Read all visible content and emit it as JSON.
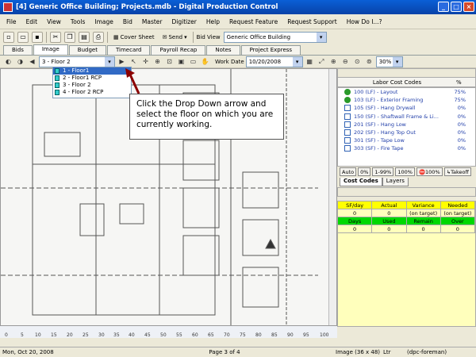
{
  "window": {
    "title": "[4] Generic Office Building; Projects.mdb - Digital Production Control"
  },
  "menu": [
    "File",
    "Edit",
    "View",
    "Tools",
    "Image",
    "Bid",
    "Master",
    "Digitizer",
    "Help",
    "Request Feature",
    "Request Support",
    "How Do I...?"
  ],
  "toolbar": {
    "cover_sheet": "Cover Sheet",
    "send": "Send",
    "bid_view_label": "Bid View",
    "bid_view_value": "Generic Office Building"
  },
  "tabs": [
    "Bids",
    "Image",
    "Budget",
    "Timecard",
    "Payroll Recap",
    "Notes",
    "Project Express"
  ],
  "imgbar": {
    "floor_value": "3 - Floor 2",
    "work_date_label": "Work Date",
    "work_date_value": "10/20/2008",
    "zoom_value": "30%"
  },
  "floors": [
    "1 - Floor1",
    "2 - Floor1 RCP",
    "3 - Floor 2",
    "4 - Floor 2 RCP"
  ],
  "callout": "Click the Drop Down arrow and select the floor on which you are currently working.",
  "labor": {
    "title": "Labor Cost Codes",
    "col_pct": "%",
    "rows": [
      {
        "code": "100 (LF) - Layout",
        "pct": "75%",
        "mark": "green"
      },
      {
        "code": "103 (LF) - Exterior Framing",
        "pct": "75%",
        "mark": "green"
      },
      {
        "code": "105 (SF) - Hang Drywall",
        "pct": "0%",
        "mark": "box"
      },
      {
        "code": "150 (SF) - Shaftwall Frame & Li...",
        "pct": "0%",
        "mark": "box"
      },
      {
        "code": "201 (SF) - Hang Low",
        "pct": "0%",
        "mark": "box"
      },
      {
        "code": "202 (SF) - Hang Top Out",
        "pct": "0%",
        "mark": "box"
      },
      {
        "code": "301 (SF) - Tape Low",
        "pct": "0%",
        "mark": "box"
      },
      {
        "code": "303 (SF) - Fire Tape",
        "pct": "0%",
        "mark": "box"
      }
    ],
    "buttons": [
      "Auto",
      "0%",
      "1-99%",
      "100%",
      "100%",
      "Takeoff"
    ],
    "tabs": [
      "Cost Codes",
      "Layers"
    ]
  },
  "stats": {
    "yellow_headers": [
      "SF/day",
      "Actual",
      "Variance",
      "Needed"
    ],
    "yellow_values": [
      "0",
      "0",
      "(on target)",
      "(on target)"
    ],
    "green_headers": [
      "Days",
      "Used",
      "Remain",
      "Over"
    ],
    "green_values": [
      "0",
      "0",
      "0",
      "0"
    ]
  },
  "ruler": [
    "0",
    "5",
    "10",
    "15",
    "20",
    "25",
    "30",
    "35",
    "40",
    "45",
    "50",
    "55",
    "60",
    "65",
    "70",
    "75",
    "80",
    "85",
    "90",
    "95",
    "100"
  ],
  "status": {
    "date": "Mon, Oct 20, 2008",
    "page": "Page 3 of 4",
    "image": "Image (36 x 48)",
    "unit": "Ltr",
    "user": "(dpc-foreman)"
  }
}
